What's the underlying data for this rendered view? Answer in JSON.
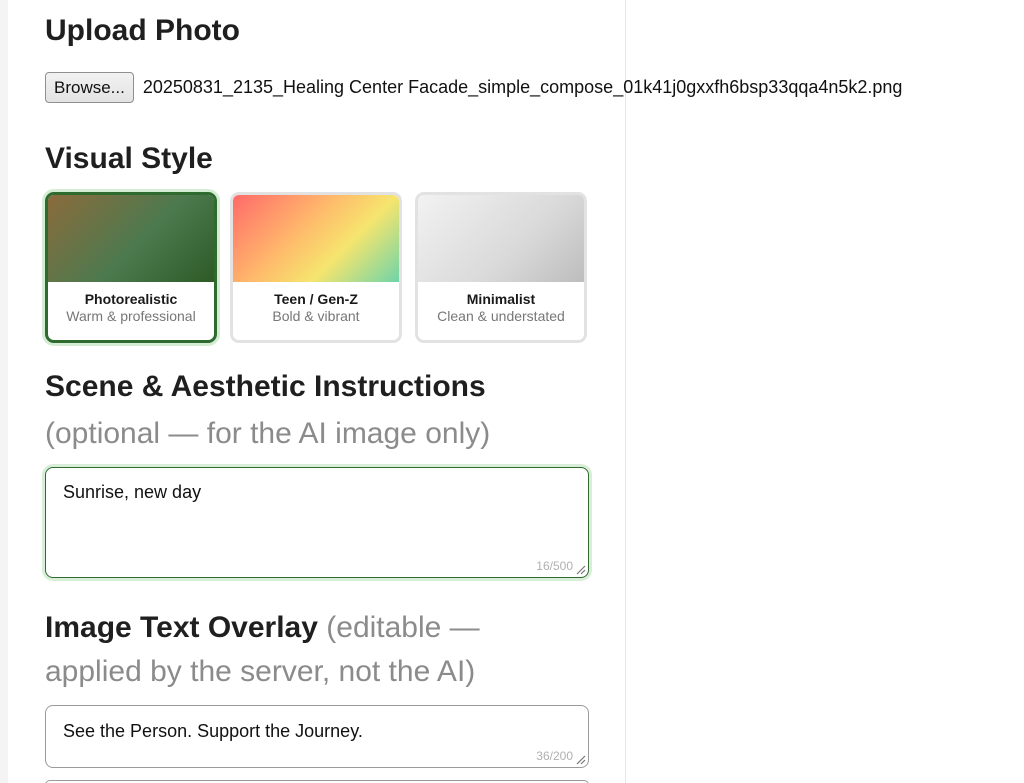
{
  "upload": {
    "heading": "Upload Photo",
    "browse_label": "Browse...",
    "file_name": "20250831_2135_Healing Center Facade_simple_compose_01k41j0gxxfh6bsp33qqa4n5k2.png"
  },
  "visual_style": {
    "heading": "Visual Style",
    "options": [
      {
        "title": "Photorealistic",
        "subtitle": "Warm & professional",
        "selected": true
      },
      {
        "title": "Teen / Gen-Z",
        "subtitle": "Bold & vibrant",
        "selected": false
      },
      {
        "title": "Minimalist",
        "subtitle": "Clean & understated",
        "selected": false
      }
    ]
  },
  "scene": {
    "heading": "Scene & Aesthetic Instructions",
    "note": "(optional — for the AI image only)",
    "value": "Sunrise, new day",
    "counter": "16/500"
  },
  "overlay": {
    "heading": "Image Text Overlay",
    "note_line1": "(editable —",
    "note_line2": "applied by the server, not the AI)",
    "value": "See the Person. Support the Journey.",
    "counter": "36/200"
  },
  "colors": {
    "accent": "#2f6a2f",
    "accent_glow": "#d4ecd4",
    "muted_text": "#8b8b8b"
  }
}
